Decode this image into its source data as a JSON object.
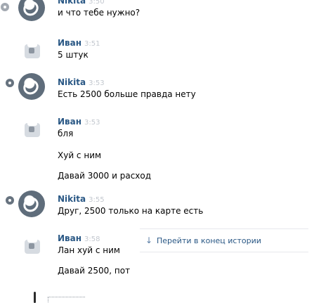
{
  "messages": [
    {
      "author": "Nikita",
      "time": "3:50",
      "text": "и что тебе нужно?"
    },
    {
      "author": "Иван",
      "time": "3:51",
      "text": "5 штук"
    },
    {
      "author": "Nikita",
      "time": "3:53",
      "text": "Есть 2500 больше правда нету"
    },
    {
      "author": "Иван",
      "time": "3:53",
      "text": "бля"
    },
    {
      "author": "",
      "time": "",
      "text": "Хуй с ним"
    },
    {
      "author": "",
      "time": "",
      "text": "Давай 3000 и расход"
    },
    {
      "author": "Nikita",
      "time": "3:55",
      "text": "Друг, 2500 только на карте есть"
    },
    {
      "author": "Иван",
      "time": "3:58",
      "text": "Лан хуй с ним"
    },
    {
      "author": "",
      "time": "",
      "text": "Давай 2500, пот"
    }
  ],
  "jump_to_end": {
    "label": "Перейти в конец истории"
  },
  "icons": {
    "status": "status-dot-icon",
    "avatar_nikita": "nikita-avatar-icon",
    "avatar_ivan": "ivan-avatar-icon",
    "jump_arrow": "arrow-down-icon"
  }
}
